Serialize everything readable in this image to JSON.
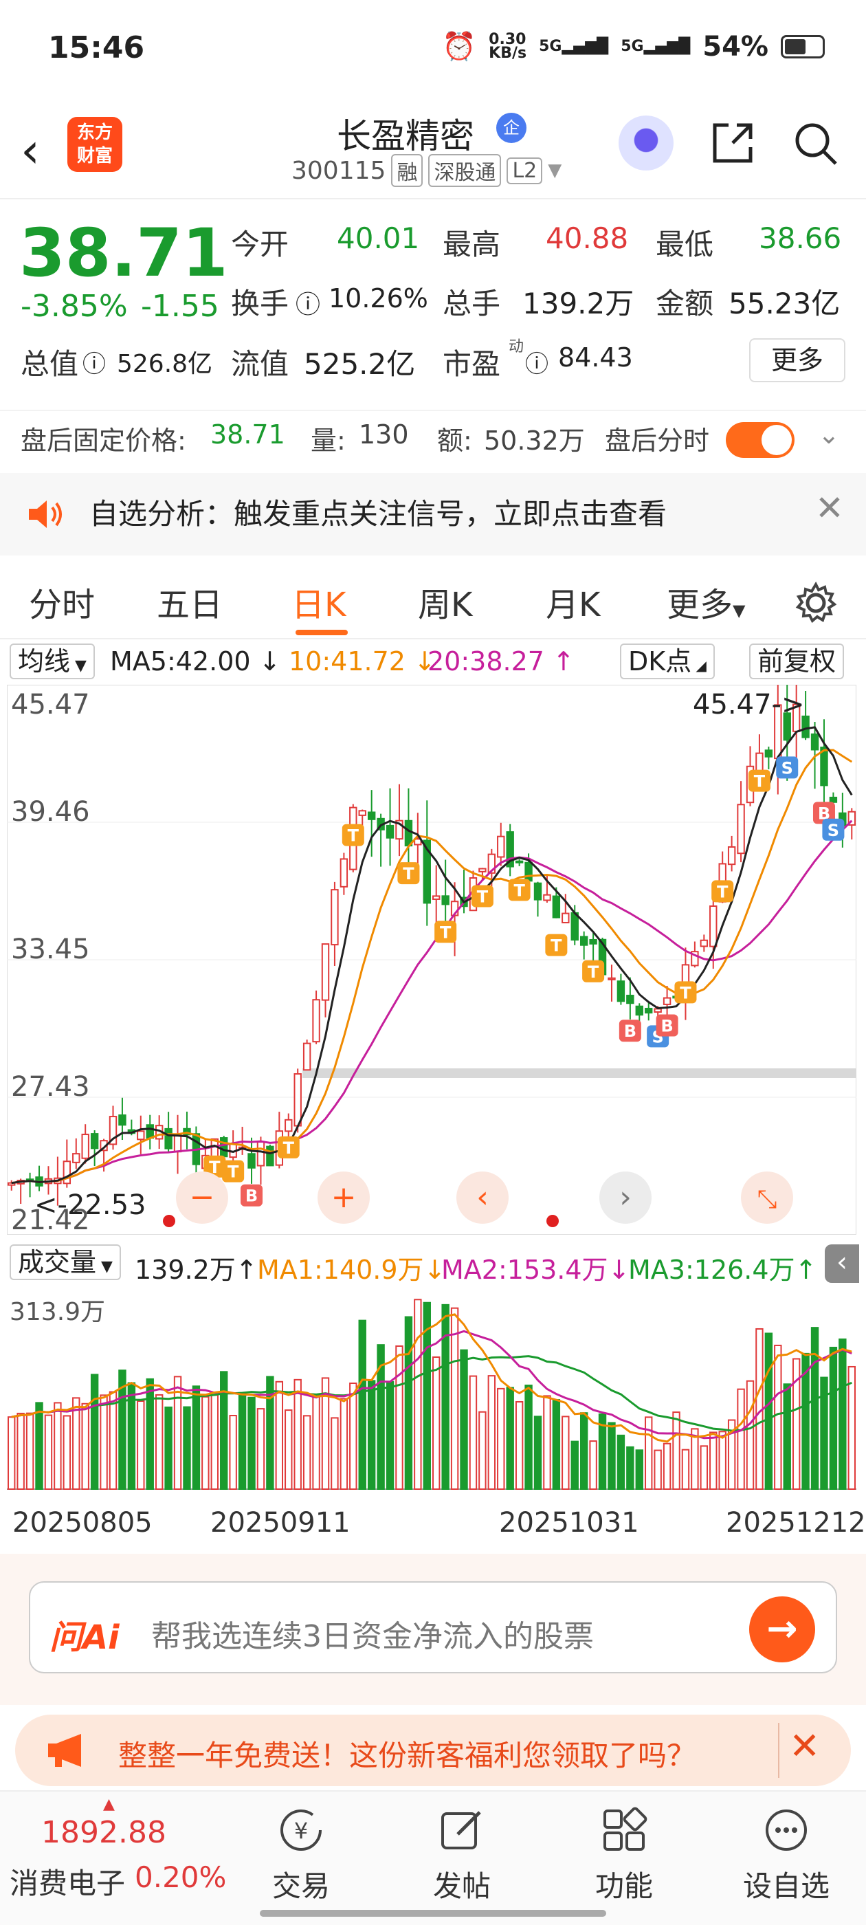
{
  "status": {
    "time": "15:46",
    "speed": "0.30",
    "speed_unit": "KB/s",
    "net1": "5G",
    "net2": "5G",
    "battery": "54%"
  },
  "header": {
    "logo_line1": "东方",
    "logo_line2": "财富",
    "name": "长盈精密",
    "badge": "企",
    "code": "300115",
    "tag1": "融",
    "tag2": "深股通",
    "tag3": "L2"
  },
  "quote": {
    "price": "38.71",
    "change_pct": "-3.85%",
    "change_val": "-1.55",
    "open_label": "今开",
    "open": "40.01",
    "high_label": "最高",
    "high": "40.88",
    "low_label": "最低",
    "low": "38.66",
    "turnover_label": "换手",
    "turnover": "10.26%",
    "volume_label": "总手",
    "volume": "139.2万",
    "amount_label": "金额",
    "amount": "55.23亿",
    "mcap_label": "总值",
    "mcap": "526.8亿",
    "float_label": "流值",
    "float_val": "525.2亿",
    "pe_label": "市盈",
    "pe_sup": "动",
    "pe": "84.43",
    "more": "更多"
  },
  "after_hours": {
    "label": "盘后固定价格:",
    "price": "38.71",
    "vol_label": "量:",
    "vol": "130",
    "amt_label": "额:",
    "amt": "50.32万",
    "time_label": "盘后分时"
  },
  "alert": {
    "text": "自选分析：触发重点关注信号，立即点击查看"
  },
  "tabs": [
    "分时",
    "五日",
    "日K",
    "周K",
    "月K",
    "更多"
  ],
  "ma": {
    "selector": "均线",
    "ma5": "MA5:42.00",
    "ma10": "10:41.72",
    "ma20": "20:38.27",
    "dk": "DK点",
    "fq": "前复权"
  },
  "chart_labels": {
    "y1": "45.47",
    "y2": "39.46",
    "y3": "33.45",
    "y4": "27.43",
    "y5": "21.42",
    "high_mark": "45.47->",
    "low_mark": "<-22.53"
  },
  "vol_row": {
    "selector": "成交量",
    "vol": "139.2万",
    "ma1": "MA1:140.9万",
    "ma2": "MA2:153.4万",
    "ma3": "MA3:126.4万",
    "max": "313.9万"
  },
  "dates": [
    "20250805",
    "20250911",
    "20251031",
    "20251212"
  ],
  "ai": {
    "logo": "问Ai",
    "placeholder": "帮我选连续3日资金净流入的股票"
  },
  "promo": {
    "text": "整整一年免费送！这份新客福利您领取了吗？"
  },
  "bottom_nav": {
    "index_value": "1892.88",
    "index_name": "消费电子",
    "index_pct": "0.20%",
    "items": [
      "交易",
      "发帖",
      "功能",
      "设自选"
    ]
  },
  "colors": {
    "up": "#e03a3a",
    "down": "#1a9b2e",
    "accent": "#ff6a1a",
    "ma5": "#222222",
    "ma10": "#f08a00",
    "ma20": "#c61f9b"
  },
  "chart_data": {
    "type": "candlestick",
    "ylim": [
      21.42,
      45.47
    ],
    "ma_lines": [
      "MA5",
      "MA10",
      "MA20"
    ],
    "high": 45.47,
    "low": 22.53,
    "volume_max": 3139000
  }
}
